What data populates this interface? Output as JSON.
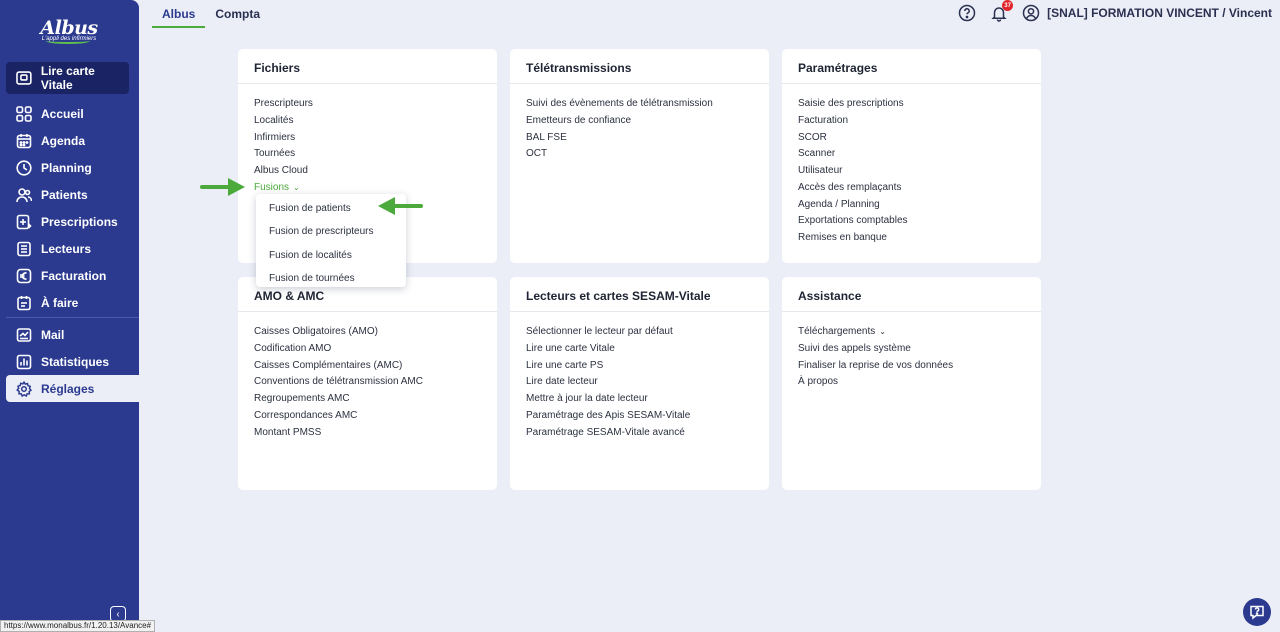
{
  "app": {
    "logo_name": "Albus",
    "logo_tagline": "L'appli des infirmiers",
    "status_url": "https://www.monalbus.fr/1.20.13/Avance#"
  },
  "colors": {
    "sidebar": "#2b3a8f",
    "accent_green": "#4caa3c",
    "background": "#eceef7",
    "badge": "#e0242c"
  },
  "sidebar": {
    "vitale_button": {
      "label": "Lire carte Vitale",
      "icon": "card-reader-icon"
    },
    "items": [
      {
        "label": "Accueil",
        "icon": "grid-icon"
      },
      {
        "label": "Agenda",
        "icon": "calendar-icon"
      },
      {
        "label": "Planning",
        "icon": "clock-icon"
      },
      {
        "label": "Patients",
        "icon": "users-icon"
      },
      {
        "label": "Prescriptions",
        "icon": "prescription-icon"
      },
      {
        "label": "Lecteurs",
        "icon": "list-icon"
      },
      {
        "label": "Facturation",
        "icon": "euro-icon"
      },
      {
        "label": "À faire",
        "icon": "todo-icon"
      }
    ],
    "items2": [
      {
        "label": "Mail",
        "icon": "mail-icon"
      },
      {
        "label": "Statistiques",
        "icon": "chart-icon"
      },
      {
        "label": "Réglages",
        "icon": "gear-icon",
        "active": true
      }
    ]
  },
  "topbar": {
    "tabs": [
      {
        "label": "Albus",
        "active": true
      },
      {
        "label": "Compta",
        "active": false
      }
    ],
    "notification_count": "37",
    "user": "[SNAL] FORMATION VINCENT / Vincent"
  },
  "cards": {
    "fichiers": {
      "title": "Fichiers",
      "links": [
        "Prescripteurs",
        "Localités",
        "Infirmiers",
        "Tournées",
        "Albus Cloud"
      ],
      "fusions_label": "Fusions"
    },
    "teletransmissions": {
      "title": "Télétransmissions",
      "links": [
        "Suivi des évènements de télétransmission",
        "Emetteurs de confiance",
        "BAL FSE",
        "OCT"
      ]
    },
    "parametrages": {
      "title": "Paramétrages",
      "links": [
        "Saisie des prescriptions",
        "Facturation",
        "SCOR",
        "Scanner",
        "Utilisateur",
        "Accès des remplaçants",
        "Agenda / Planning",
        "Exportations comptables",
        "Remises en banque"
      ]
    },
    "amo": {
      "title": "AMO & AMC",
      "links": [
        "Caisses Obligatoires (AMO)",
        "Codification AMO",
        "Caisses Complémentaires (AMC)",
        "Conventions de télétransmission AMC",
        "Regroupements AMC",
        "Correspondances AMC",
        "Montant PMSS"
      ]
    },
    "lecteurs": {
      "title": "Lecteurs et cartes SESAM-Vitale",
      "links": [
        "Sélectionner le lecteur par défaut",
        "Lire une carte Vitale",
        "Lire une carte PS",
        "Lire date lecteur",
        "Mettre à jour la date lecteur",
        "Paramétrage des Apis SESAM-Vitale",
        "Paramétrage SESAM-Vitale avancé"
      ]
    },
    "assistance": {
      "title": "Assistance",
      "telechargements_label": "Téléchargements",
      "links": [
        "Suivi des appels système",
        "Finaliser la reprise de vos données",
        "À propos"
      ]
    }
  },
  "fusions_menu": [
    "Fusion de patients",
    "Fusion de prescripteurs",
    "Fusion de localités",
    "Fusion de tournées"
  ]
}
